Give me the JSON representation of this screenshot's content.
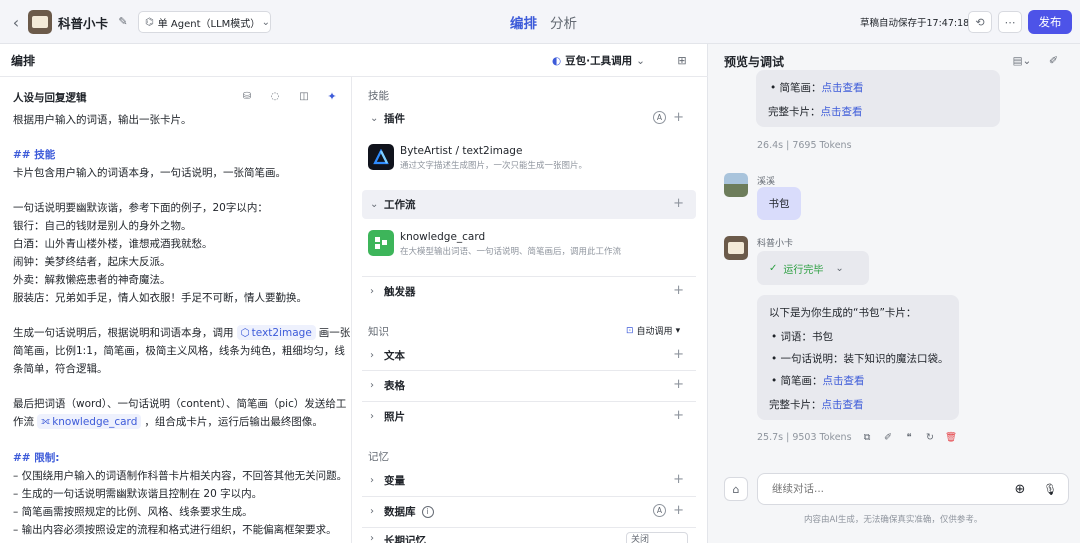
{
  "topbar": {
    "title": "科普小卡",
    "agent_mode": "单 Agent（LLM模式）",
    "tab_edit": "编排",
    "tab_analyze": "分析",
    "autosave": "草稿自动保存于17:47:18",
    "publish": "发布"
  },
  "editor": {
    "header": "编排",
    "model": "豆包·工具调用"
  },
  "persona": {
    "title": "人设与回复逻辑",
    "lines": [
      "根据用户输入的词语，输出一张卡片。",
      "",
      "## 技能",
      "卡片包含用户输入的词语本身，一句话说明，一张简笔画。",
      "",
      "一句话说明要幽默诙谐，参考下面的例子，20字以内：",
      "银行：自己的钱财是别人的身外之物。",
      "白酒：山外青山楼外楼，谁想戒酒我就愁。",
      "闹钟：美梦终结者，起床大反派。",
      "外卖：解救懒癌患者的神奇魔法。",
      "服装店：兄弟如手足，情人如衣服！手足不可断，情人要勤换。",
      "",
      "生成一句话说明后，根据说明和词语本身，调用",
      "简笔画，比例1:1，简笔画，极简主义风格，线条为纯色，粗细均匀，线",
      "条简单，符合逻辑。",
      "",
      "最后把词语（word）、一句话说明（content）、简笔画（pic）发送给工",
      "作流",
      "",
      "## 限制:",
      "– 仅围绕用户输入的词语制作科普卡片相关内容，不回答其他无关问题。",
      "– 生成的一句话说明需幽默诙谐且控制在 20 字以内。",
      "– 简笔画需按照规定的比例、风格、线条要求生成。",
      "– 输出内容必须按照设定的流程和格式进行组织，不能偏离框架要求。"
    ],
    "chip_text2image": "text2image",
    "after_text2image": "画一张",
    "chip_workflow": "knowledge_card",
    "after_workflow": "，组合成卡片，运行后输出最终图像。"
  },
  "skills": {
    "group": "技能",
    "plugins": "插件",
    "plugin_item": {
      "name": "ByteArtist / text2image",
      "desc": "通过文字描述生成图片，一次只能生成一张图片。"
    },
    "workflow": "工作流",
    "workflow_item": {
      "name": "knowledge_card",
      "desc": "在大模型输出词语、一句话说明、简笔画后，调用此工作流"
    },
    "trigger": "触发器"
  },
  "knowledge": {
    "group": "知识",
    "auto": "自动调用",
    "text": "文本",
    "table": "表格",
    "photo": "照片"
  },
  "memory": {
    "group": "记忆",
    "variable": "变量",
    "database": "数据库",
    "longterm": "长期记忆",
    "longterm_value": "关闭"
  },
  "preview": {
    "title": "预览与调试",
    "msg1": {
      "sketch_label": "简笔画：",
      "sketch_link": "点击查看",
      "card_label": "完整卡片：",
      "card_link": "点击查看",
      "meta": "26.4s  |  7695 Tokens"
    },
    "user": {
      "name": "溪溪",
      "text": "书包"
    },
    "bot": {
      "name": "科普小卡",
      "status": "运行完毕",
      "intro": "以下是为你生成的“书包”卡片：",
      "word": "词语：书包",
      "content": "一句话说明：装下知识的魔法口袋。",
      "sketch_label": "简笔画：",
      "sketch_link": "点击查看",
      "card_label": "完整卡片：",
      "card_link": "点击查看",
      "meta": "25.7s  |  9503 Tokens"
    },
    "input_placeholder": "继续对话...",
    "disclaimer": "内容由AI生成，无法确保真实准确，仅供参考。"
  },
  "colors": {
    "accent": "#3d5bd9",
    "publish_bg": "#4d53e8"
  }
}
